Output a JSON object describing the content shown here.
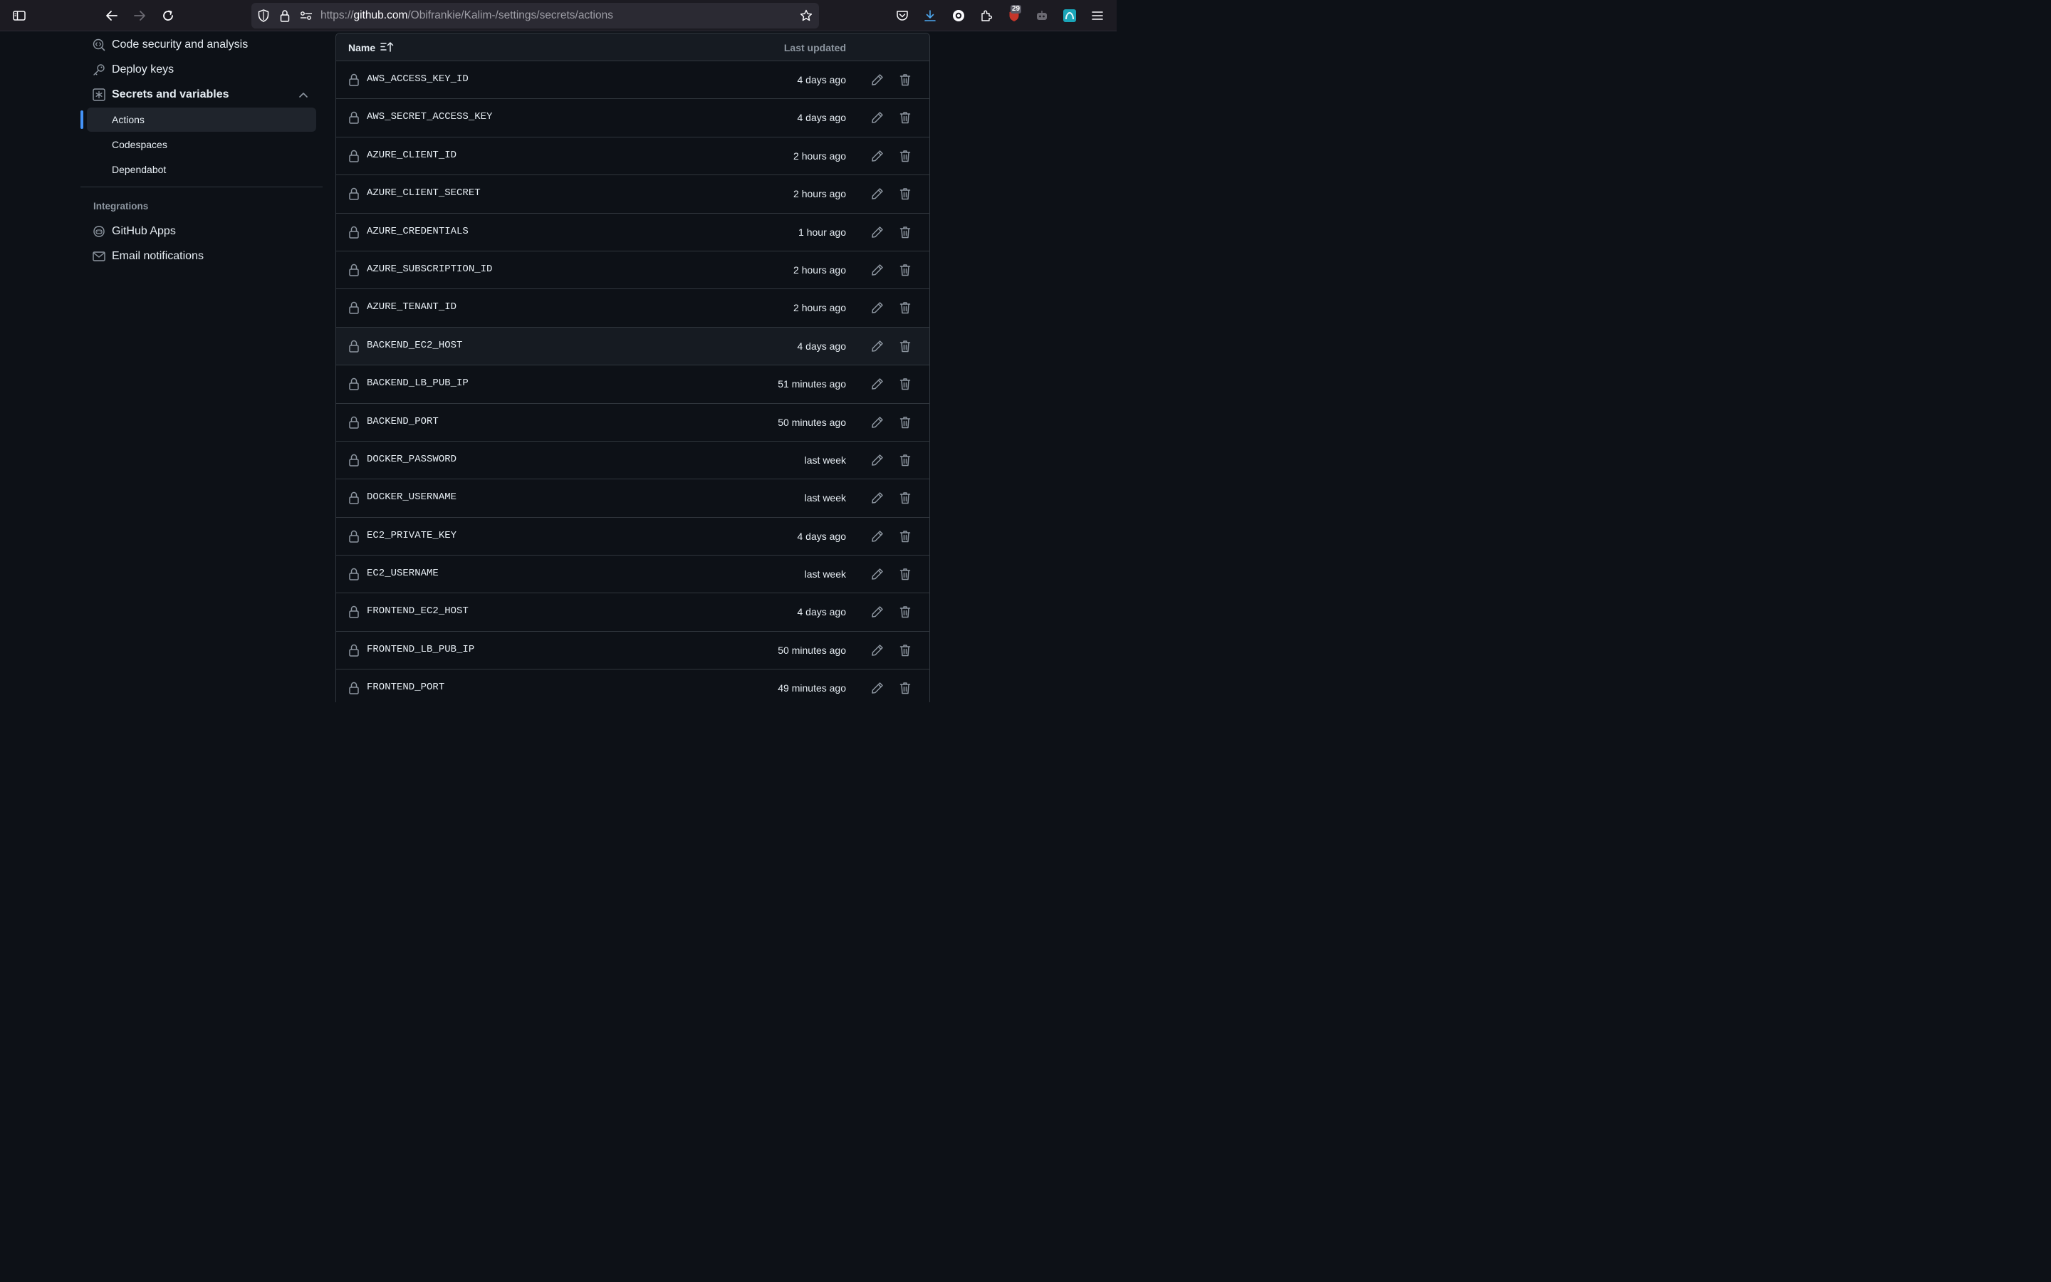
{
  "browser": {
    "url_prefix": "https://",
    "url_domain": "github.com",
    "url_path": "/Obifrankie/Kalim-/settings/secrets/actions",
    "extension_badge": "29"
  },
  "sidebar": {
    "items": [
      {
        "label": "Code security and analysis",
        "icon": "codescan-icon"
      },
      {
        "label": "Deploy keys",
        "icon": "key-icon"
      },
      {
        "label": "Secrets and variables",
        "icon": "asterisk-icon"
      }
    ],
    "subitems": [
      {
        "label": "Actions",
        "active": true
      },
      {
        "label": "Codespaces",
        "active": false
      },
      {
        "label": "Dependabot",
        "active": false
      }
    ],
    "integrations_heading": "Integrations",
    "integrations": [
      {
        "label": "GitHub Apps",
        "icon": "github-apps-icon"
      },
      {
        "label": "Email notifications",
        "icon": "mail-icon"
      }
    ]
  },
  "table": {
    "header_name": "Name",
    "header_updated": "Last updated",
    "rows": [
      {
        "name": "AWS_ACCESS_KEY_ID",
        "updated": "4 days ago"
      },
      {
        "name": "AWS_SECRET_ACCESS_KEY",
        "updated": "4 days ago"
      },
      {
        "name": "AZURE_CLIENT_ID",
        "updated": "2 hours ago"
      },
      {
        "name": "AZURE_CLIENT_SECRET",
        "updated": "2 hours ago"
      },
      {
        "name": "AZURE_CREDENTIALS",
        "updated": "1 hour ago"
      },
      {
        "name": "AZURE_SUBSCRIPTION_ID",
        "updated": "2 hours ago"
      },
      {
        "name": "AZURE_TENANT_ID",
        "updated": "2 hours ago"
      },
      {
        "name": "BACKEND_EC2_HOST",
        "updated": "4 days ago"
      },
      {
        "name": "BACKEND_LB_PUB_IP",
        "updated": "51 minutes ago"
      },
      {
        "name": "BACKEND_PORT",
        "updated": "50 minutes ago"
      },
      {
        "name": "DOCKER_PASSWORD",
        "updated": "last week"
      },
      {
        "name": "DOCKER_USERNAME",
        "updated": "last week"
      },
      {
        "name": "EC2_PRIVATE_KEY",
        "updated": "4 days ago"
      },
      {
        "name": "EC2_USERNAME",
        "updated": "last week"
      },
      {
        "name": "FRONTEND_EC2_HOST",
        "updated": "4 days ago"
      },
      {
        "name": "FRONTEND_LB_PUB_IP",
        "updated": "50 minutes ago"
      },
      {
        "name": "FRONTEND_PORT",
        "updated": "49 minutes ago"
      }
    ]
  },
  "colors": {
    "page_bg": "#0d1117",
    "accent": "#4493f8",
    "border": "#30363d"
  }
}
